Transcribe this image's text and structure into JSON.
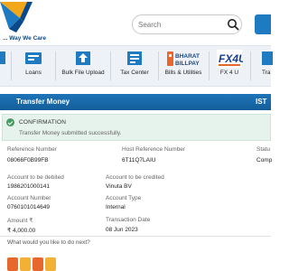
{
  "header": {
    "logo_tagline": "... Way We Care",
    "search_placeholder": "Search"
  },
  "nav": {
    "items": [
      {
        "label": "Loans",
        "icon": "loans-icon"
      },
      {
        "label": "Bulk File Upload",
        "icon": "bulk-file-upload-icon"
      },
      {
        "label": "Tax Center",
        "icon": "tax-center-icon"
      },
      {
        "label": "Bills & Utilities",
        "icon": "bharat-billpay-icon",
        "logo_text": "BHARAT BILLPAY"
      },
      {
        "label": "FX 4 U",
        "icon": "fx4u-icon",
        "logo_text": "FX4U"
      },
      {
        "label": "Tra",
        "icon": "trade-icon"
      }
    ]
  },
  "page": {
    "title": "Transfer Money",
    "title_right": "IST"
  },
  "confirmation": {
    "title": "CONFIRMATION",
    "message": "Transfer Money submitted successfully."
  },
  "details": {
    "reference_number_label": "Reference Number",
    "reference_number": "08066F0B99FB",
    "host_reference_label": "Host Reference Number",
    "host_reference": "6T11Q7LAIU",
    "status_label": "Statu",
    "status": "Comp",
    "debited_label": "Account to be debited",
    "debited": "1986201000141",
    "credited_label": "Account to be credited",
    "credited": "Vinuta BV",
    "account_number_label": "Account Number",
    "account_number": "0760101014649",
    "account_type_label": "Account Type",
    "account_type": "Internal",
    "amount_label": "Amount ₹",
    "amount": "₹ 4,000.00",
    "transaction_date_label": "Transaction Date",
    "transaction_date": "08 Jun 2023",
    "next_question": "What would you like to do next?"
  },
  "colors": {
    "brand_blue": "#1d74b8",
    "confirm_green": "#4a9a63",
    "quick_orange": "#e8672c",
    "quick_yellow": "#f2b134"
  }
}
